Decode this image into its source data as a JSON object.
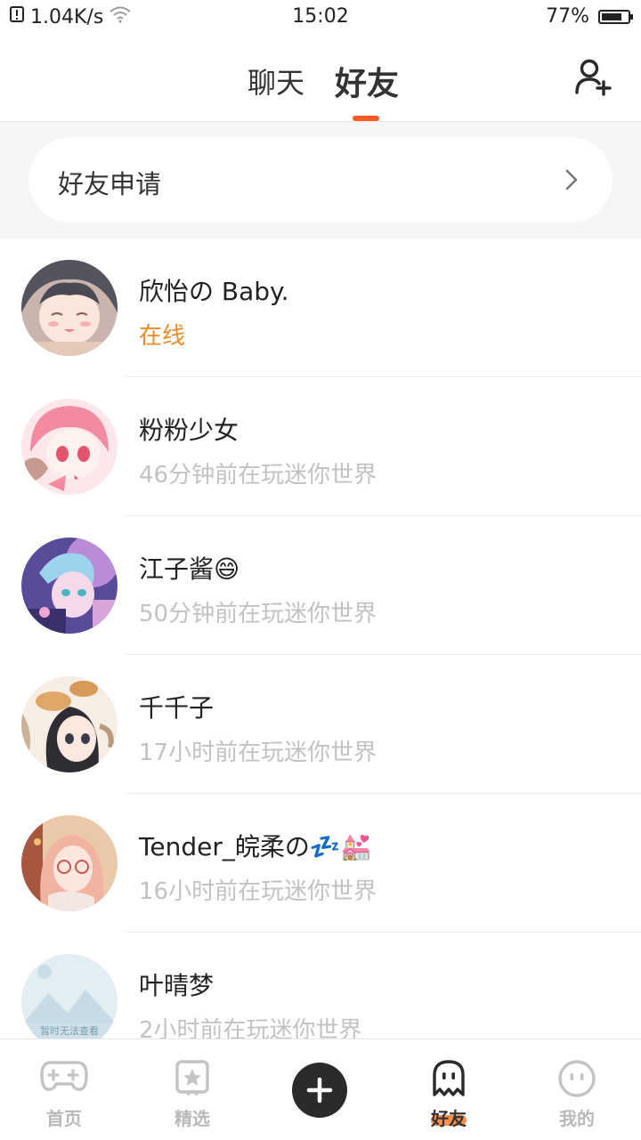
{
  "status_bar": {
    "speed": "1.04K/s",
    "time": "15:02",
    "battery": "77%",
    "battery_level": 0.77
  },
  "header": {
    "tabs": [
      {
        "label": "聊天",
        "active": false
      },
      {
        "label": "好友",
        "active": true
      }
    ],
    "add_friend_icon": "add-user-icon"
  },
  "friend_request": {
    "label": "好友申请"
  },
  "friends": [
    {
      "name": "欣怡の Baby.",
      "status": "在线",
      "online": true
    },
    {
      "name": "粉粉少女",
      "status": "46分钟前在玩迷你世界",
      "online": false
    },
    {
      "name": "江子酱😄",
      "status": "50分钟前在玩迷你世界",
      "online": false
    },
    {
      "name": "千千子",
      "status": "17小时前在玩迷你世界",
      "online": false
    },
    {
      "name": "Tender_皖柔の💤💒",
      "status": "16小时前在玩迷你世界",
      "online": false
    },
    {
      "name": "叶晴梦",
      "status": "2小时前在玩迷你世界",
      "online": false,
      "avatar_placeholder": "暂时无法查看"
    }
  ],
  "bottom_nav": {
    "items": [
      {
        "label": "首页",
        "icon": "gamepad-icon"
      },
      {
        "label": "精选",
        "icon": "star-icon"
      },
      {
        "label": "",
        "icon": "plus-icon"
      },
      {
        "label": "好友",
        "icon": "ghost-icon",
        "active": true
      },
      {
        "label": "我的",
        "icon": "face-icon"
      }
    ]
  },
  "colors": {
    "accent": "#ff5a1f",
    "online": "#f08a24",
    "muted": "#c2c2c2"
  }
}
